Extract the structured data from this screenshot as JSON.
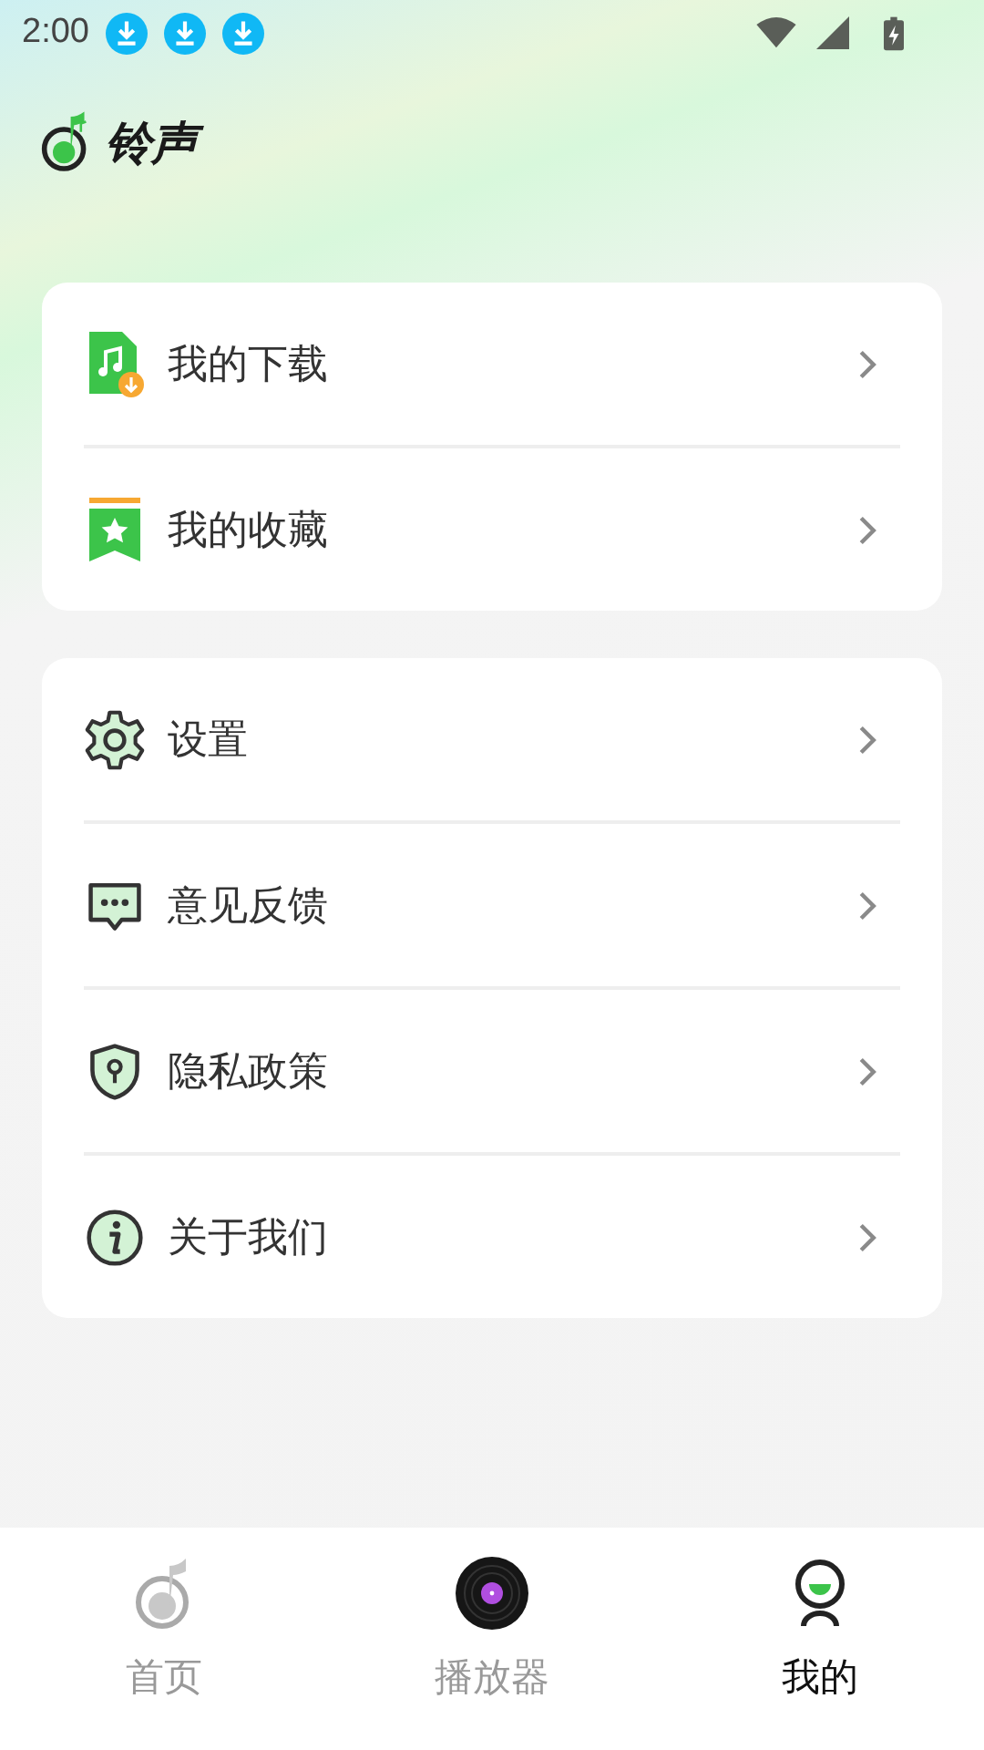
{
  "status_bar": {
    "time": "2:00",
    "notifications": [
      {
        "kind": "download"
      },
      {
        "kind": "download"
      },
      {
        "kind": "download"
      }
    ]
  },
  "header": {
    "title": "铃声"
  },
  "menu_groups": [
    {
      "items": [
        {
          "kind": "download",
          "label": "我的下载"
        },
        {
          "kind": "favorite",
          "label": "我的收藏"
        }
      ]
    },
    {
      "items": [
        {
          "kind": "settings",
          "label": "设置"
        },
        {
          "kind": "feedback",
          "label": "意见反馈"
        },
        {
          "kind": "privacy",
          "label": "隐私政策"
        },
        {
          "kind": "about",
          "label": "关于我们"
        }
      ]
    }
  ],
  "bottom_nav": [
    {
      "kind": "home",
      "label": "首页",
      "selected": false
    },
    {
      "kind": "player",
      "label": "播放器",
      "selected": false
    },
    {
      "kind": "mine",
      "label": "我的",
      "selected": true
    }
  ]
}
